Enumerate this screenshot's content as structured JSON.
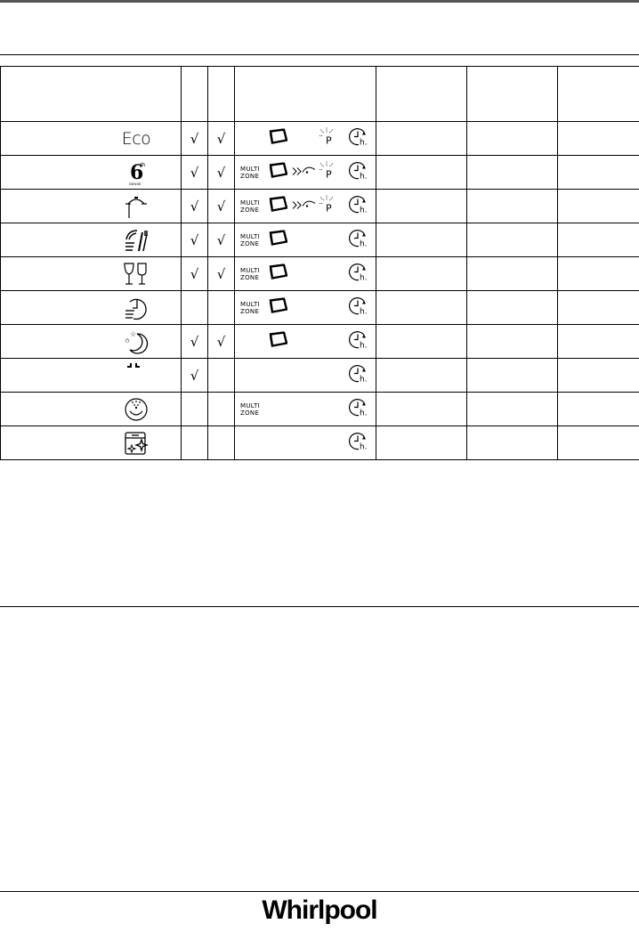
{
  "header": {
    "columns": [
      "",
      "",
      "",
      "",
      "",
      "",
      ""
    ]
  },
  "programs": [
    {
      "name_icon": "eco-text",
      "icon_label": "Eco",
      "check1": "√",
      "check2": "√",
      "multizone": false,
      "tablet": true,
      "turbo": false,
      "power": true,
      "timer": true
    },
    {
      "name_icon": "6th-sense-icon",
      "icon_label": "6",
      "icon_sup": "th",
      "icon_sub": "SENSE",
      "check1": "√",
      "check2": "√",
      "multizone": true,
      "tablet": true,
      "turbo": true,
      "power": true,
      "timer": true
    },
    {
      "name_icon": "intensive-pot-icon",
      "check1": "√",
      "check2": "√",
      "multizone": true,
      "tablet": true,
      "turbo": true,
      "power": true,
      "timer": true
    },
    {
      "name_icon": "daily-dishes-icon",
      "check1": "√",
      "check2": "√",
      "multizone": true,
      "tablet": true,
      "turbo": false,
      "power": false,
      "timer": true
    },
    {
      "name_icon": "glasses-icon",
      "check1": "√",
      "check2": "√",
      "multizone": true,
      "tablet": true,
      "turbo": false,
      "power": false,
      "timer": true
    },
    {
      "name_icon": "quick-wash-icon",
      "check1": "",
      "check2": "",
      "multizone": true,
      "tablet": true,
      "turbo": false,
      "power": false,
      "timer": true
    },
    {
      "name_icon": "night-moon-icon",
      "check1": "√",
      "check2": "√",
      "multizone": false,
      "tablet": true,
      "turbo": false,
      "power": false,
      "timer": true
    },
    {
      "name_icon": "prewash-icon",
      "check1": "√",
      "check2": "",
      "multizone": false,
      "tablet": false,
      "turbo": false,
      "power": false,
      "timer": true
    },
    {
      "name_icon": "hygiene-icon",
      "check1": "",
      "check2": "",
      "multizone": true,
      "tablet": false,
      "turbo": false,
      "power": false,
      "timer": true
    },
    {
      "name_icon": "self-clean-icon",
      "check1": "",
      "check2": "",
      "multizone": false,
      "tablet": false,
      "turbo": false,
      "power": false,
      "timer": true
    }
  ],
  "labels": {
    "multizone_line1": "MULTI",
    "multizone_line2": "ZONE",
    "timer_h": "h.",
    "power_p": "P"
  },
  "footer": {
    "brand": "Whirlpool"
  }
}
